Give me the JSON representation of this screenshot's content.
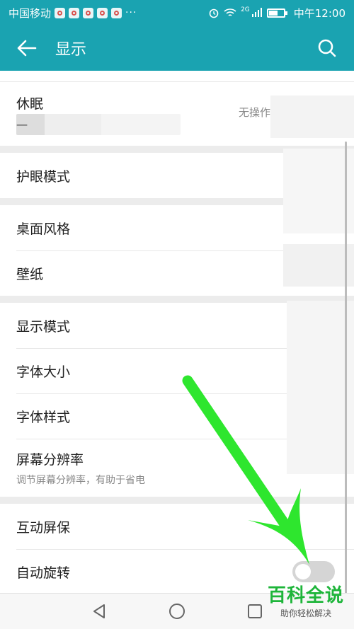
{
  "statusbar": {
    "carrier": "中国移动",
    "more": "···",
    "network": "2G",
    "time": "中午12:00"
  },
  "appbar": {
    "title": "显示",
    "back_icon": "arrow-left-icon",
    "search_icon": "search-icon"
  },
  "sections": {
    "sleep": {
      "label": "休眠",
      "value": "无操作",
      "sub": "一"
    },
    "eye": {
      "label": "护眼模式"
    },
    "desktop_style": {
      "label": "桌面风格"
    },
    "wallpaper": {
      "label": "壁纸"
    },
    "display_mode": {
      "label": "显示模式"
    },
    "font_size": {
      "label": "字体大小"
    },
    "font_style": {
      "label": "字体样式"
    },
    "resolution": {
      "label": "屏幕分辨率",
      "sub": "调节屏幕分辨率，有助于省电"
    },
    "screensaver": {
      "label": "互动屏保"
    },
    "autorotate": {
      "label": "自动旋转",
      "enabled": false
    }
  },
  "watermark": {
    "brand": "百科全说",
    "slogan": "助你轻松解决"
  },
  "colors": {
    "appbar": "#1aa3b1",
    "arrow": "#2ee62e"
  }
}
